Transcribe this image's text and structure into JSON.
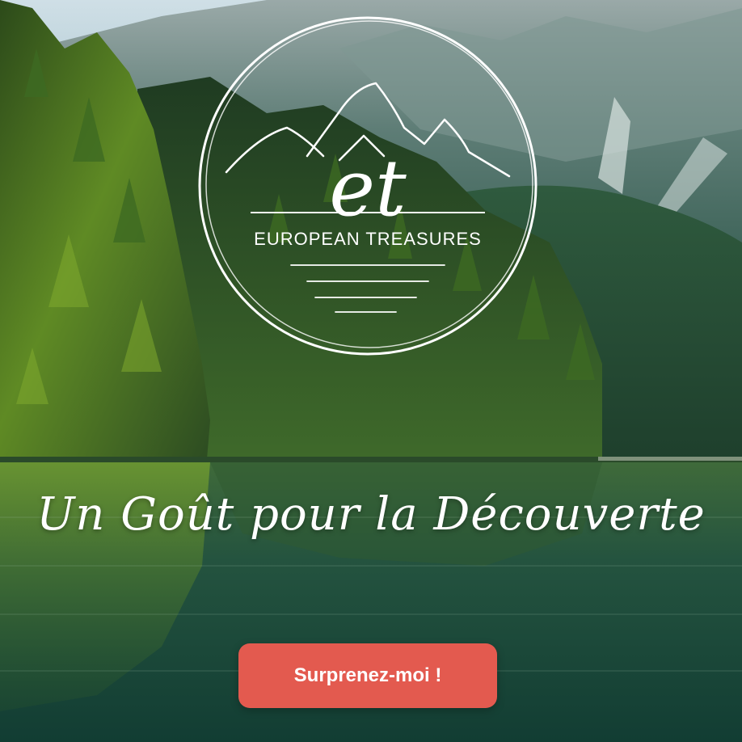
{
  "hero": {
    "tagline": "Un Goût pour la Découverte",
    "cta_label": "Surprenez-moi !"
  },
  "logo": {
    "monogram": "et",
    "brand_name": "EUROPEAN TREASURES",
    "icon": "mountain-icon"
  },
  "colors": {
    "cta_background": "#e35a4f",
    "cta_text": "#ffffff",
    "logo_stroke": "#ffffff"
  }
}
